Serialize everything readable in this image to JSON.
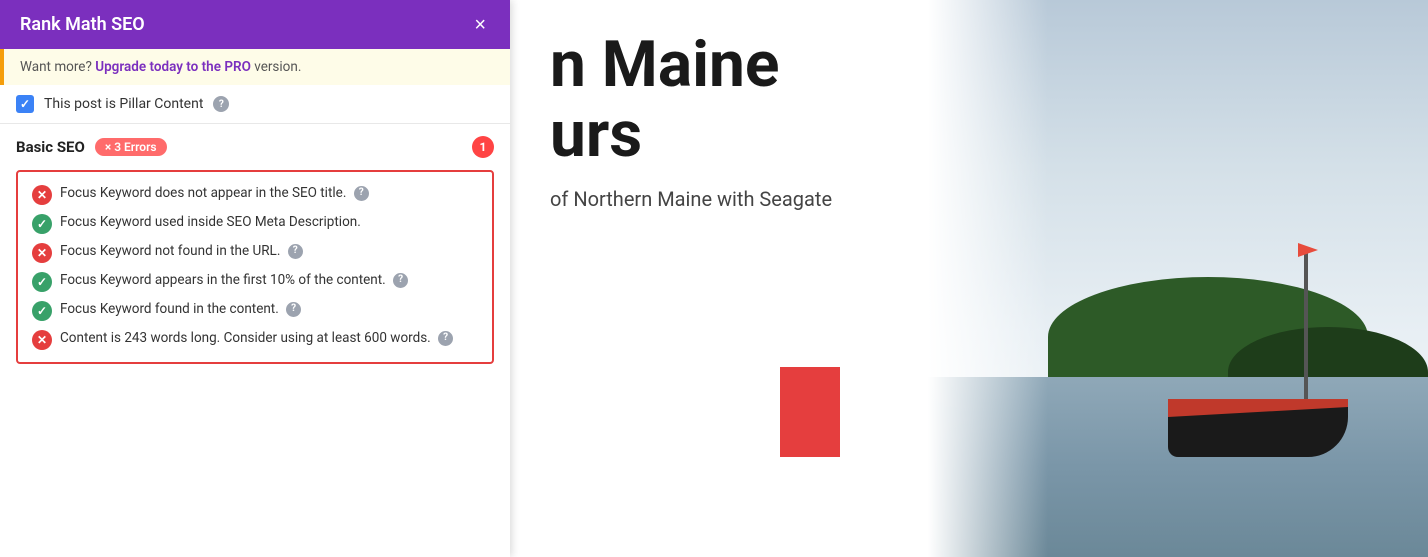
{
  "panel": {
    "title": "Rank Math SEO",
    "close_label": "×",
    "upgrade_banner": {
      "text": "Want more?",
      "link_text": "Upgrade today to the PRO",
      "suffix": " version."
    },
    "pillar_content": {
      "label": "This post is Pillar Content",
      "checked": true
    },
    "basic_seo": {
      "section_title": "Basic SEO",
      "errors_badge": "× 3 Errors",
      "notification_number": "1",
      "checks": [
        {
          "type": "error",
          "text": "Focus Keyword does not appear in the SEO title.",
          "has_help": true
        },
        {
          "type": "success",
          "text": "Focus Keyword used inside SEO Meta Description.",
          "has_help": false
        },
        {
          "type": "error",
          "text": "Focus Keyword not found in the URL.",
          "has_help": true
        },
        {
          "type": "success",
          "text": "Focus Keyword appears in the first 10% of the content.",
          "has_help": true
        },
        {
          "type": "success",
          "text": "Focus Keyword found in the content.",
          "has_help": true
        },
        {
          "type": "error",
          "text": "Content is 243 words long. Consider using at least 600 words.",
          "has_help": true
        }
      ]
    }
  },
  "content": {
    "title_line1": "n Maine",
    "title_line2": "urs",
    "subtitle": "of Northern Maine with Seagate"
  },
  "icons": {
    "check": "✓",
    "cross": "✕",
    "question": "?"
  }
}
